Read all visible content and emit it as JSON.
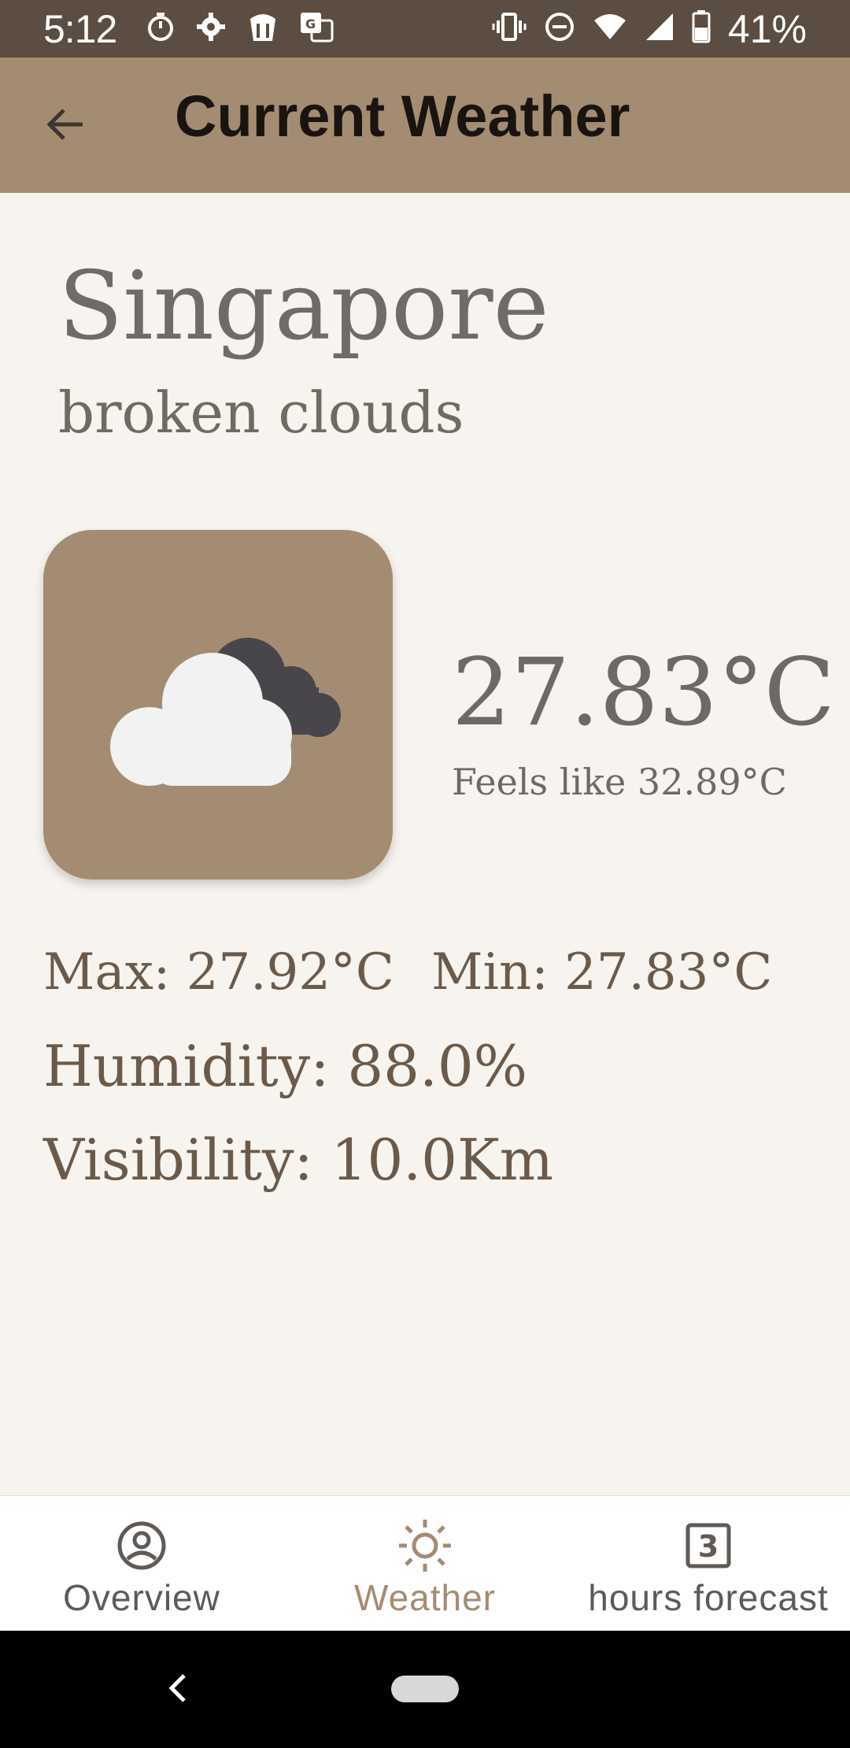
{
  "status_bar": {
    "time": "5:12",
    "battery": "41%",
    "icons_left": [
      "timer-icon",
      "settings-gear-icon",
      "ai-bot-icon",
      "translate-icon"
    ],
    "icons_right": [
      "vibrate-icon",
      "do-not-disturb-icon",
      "wifi-icon",
      "signal-icon",
      "battery-icon"
    ]
  },
  "app_bar": {
    "title": "Current Weather",
    "back_icon": "arrow-left-icon"
  },
  "weather": {
    "city": "Singapore",
    "condition": "broken clouds",
    "icon": "broken-clouds-icon",
    "temperature": "27.83°C",
    "feels_like": "Feels like 32.89°C",
    "max": "Max: 27.92°C",
    "min": "Min: 27.83°C",
    "humidity": "Humidity: 88.0%",
    "visibility": "Visibility: 10.0Km"
  },
  "bottom_nav": {
    "items": [
      {
        "label": "Overview",
        "icon": "account-circle-icon",
        "active": false
      },
      {
        "label": "Weather",
        "icon": "sun-icon",
        "active": true
      },
      {
        "label": "hours forecast",
        "icon": "number-3-box-icon",
        "active": false
      }
    ]
  },
  "colors": {
    "status_bar": "#5b4d41",
    "app_bar": "#a48c72",
    "background": "#f7f3ee",
    "accent": "#a48c72"
  }
}
